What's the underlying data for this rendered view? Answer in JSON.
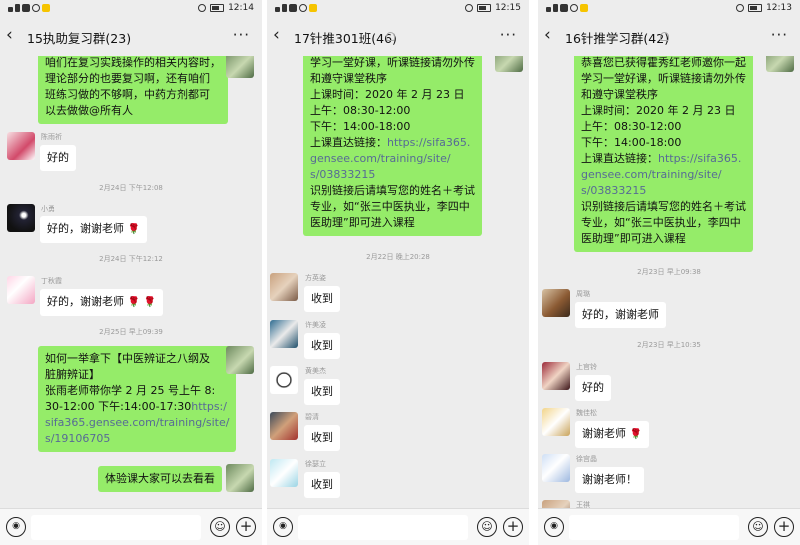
{
  "status": {
    "s1": {
      "time": "12:14"
    },
    "s2": {
      "time": "12:15"
    },
    "s3": {
      "time": "12:13"
    }
  },
  "s1": {
    "title": "15执助复习群(23)",
    "top_text": [
      "咱们在复习实践操作的相关内容时，",
      "理论部分的也要复习啊，还有咱们",
      "班练习做的不够啊，中药方剂都可",
      "以去做做@所有人"
    ],
    "m1": {
      "nick": "陈雨祈",
      "text": "好的"
    },
    "t1": "2月24日 下午12:08",
    "m2": {
      "nick": "小勇",
      "text": "好的，谢谢老师"
    },
    "t2": "2月24日 下午12:12",
    "m3": {
      "nick": "丁秋霞",
      "text": "好的，谢谢老师"
    },
    "t3": "2月25日 早上09:39",
    "m4": {
      "lines": [
        "如何一举拿下【中医辨证之八纲及",
        "脏腑辨证】",
        "张雨老师带你学 2 月 25 号上午 8:",
        "30-12:00   下午:14:00-17:30"
      ],
      "link_a": "https:/",
      "link_b": "sifa365.gensee.com/training/site/",
      "link_c": "s/19106705"
    },
    "m5": {
      "text": "体验课大家可以去看看"
    },
    "rose": "🌹"
  },
  "s2": {
    "title": "17针推301班(46)",
    "top_lines": [
      "学习一堂好课，听课链接请勿外传",
      "和遵守课堂秩序",
      "上课时间：2020 年 2 月 23 日",
      "上午：08:30-12:00",
      "下午：14:00-18:00",
      "上课直达链接："
    ],
    "link_a": "https://sifa365.",
    "link_b": "gensee.com/training/site/",
    "link_c": "s/03833215",
    "tail_lines": [
      "  识别链接后请填写您的姓名＋考试",
      "专业，如“张三中医执业，李四中",
      "医助理”即可进入课程"
    ],
    "t1": "2月22日 晚上20:28",
    "m1": {
      "nick": "方英姿",
      "text": "收到"
    },
    "m2": {
      "nick": "许美凌",
      "text": "收到"
    },
    "m3": {
      "nick": "黄美杰",
      "text": "收到"
    },
    "m4": {
      "nick": "碧清",
      "text": "收到"
    },
    "m5": {
      "nick": "徐瑟立",
      "text": "收到"
    }
  },
  "s3": {
    "title": "16针推学习群(42)",
    "top_lines": [
      "恭喜您已获得霍秀红老师邀你一起",
      "学习一堂好课，听课链接请勿外传",
      "和遵守课堂秩序",
      "上课时间：2020 年 2 月 23 日",
      "上午：08:30-12:00",
      "下午：14:00-18:00",
      "上课直达链接："
    ],
    "link_a": "https://sifa365.",
    "link_b": "gensee.com/training/site/",
    "link_c": "s/03833215",
    "tail_lines": [
      "  识别链接后请填写您的姓名＋考试",
      "专业，如“张三中医执业，李四中",
      "医助理”即可进入课程"
    ],
    "t1": "2月23日 早上09:38",
    "m1": {
      "nick": "周璐",
      "text": "好的，谢谢老师"
    },
    "t2": "2月23日 早上10:35",
    "m2": {
      "nick": "上官铃",
      "text": "好的"
    },
    "m3": {
      "nick": "魏佳松",
      "text": "谢谢老师"
    },
    "m4": {
      "nick": "徐宫晶",
      "text": "谢谢老师！"
    },
    "m5": {
      "nick": "王祺"
    }
  },
  "icons": {
    "back": "‹",
    "more": "···",
    "voice": "◉",
    "emoji": "☺",
    "plus": "+"
  }
}
